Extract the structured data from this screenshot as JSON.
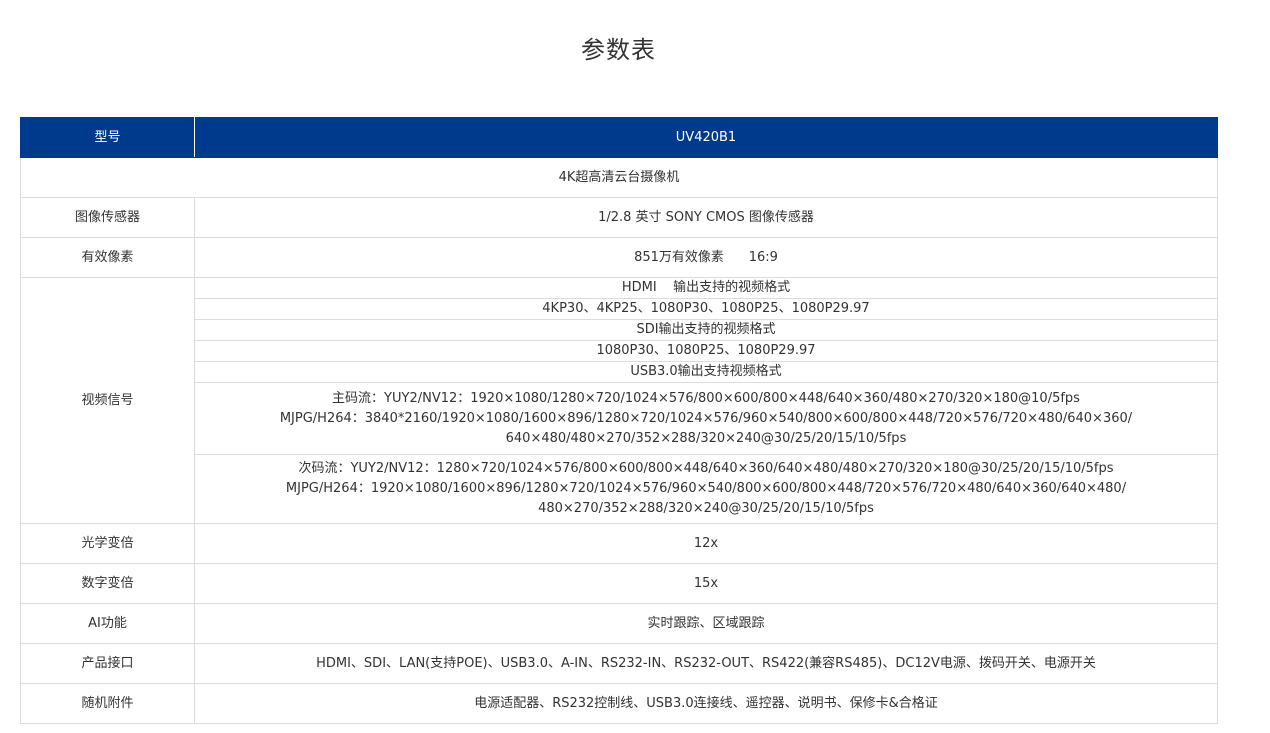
{
  "page": {
    "title": "参数表"
  },
  "table": {
    "header": {
      "label": "型号",
      "value": "UV420B1"
    },
    "product_name": "4K超高清云台摄像机",
    "rows": [
      {
        "label": "图像传感器",
        "value": "1/2.8 英寸 SONY CMOS 图像传感器"
      },
      {
        "label": "有效像素",
        "value": "851万有效像素      16:9"
      }
    ],
    "video": {
      "label": "视频信号",
      "lines": [
        "HDMI    输出支持的视频格式",
        "4KP30、4KP25、1080P30、1080P25、1080P29.97",
        "SDI输出支持的视频格式",
        "1080P30、1080P25、1080P29.97",
        "USB3.0输出支持视频格式"
      ],
      "main_stream": [
        "主码流：YUY2/NV12：1920×1080/1280×720/1024×576/800×600/800×448/640×360/480×270/320×180@10/5fps",
        "MJPG/H264：3840*2160/1920×1080/1600×896/1280×720/1024×576/960×540/800×600/800×448/720×576/720×480/640×360/",
        "640×480/480×270/352×288/320×240@30/25/20/15/10/5fps"
      ],
      "sub_stream": [
        "次码流：YUY2/NV12：1280×720/1024×576/800×600/800×448/640×360/640×480/480×270/320×180@30/25/20/15/10/5fps",
        "MJPG/H264：1920×1080/1600×896/1280×720/1024×576/960×540/800×600/800×448/720×576/720×480/640×360/640×480/",
        "480×270/352×288/320×240@30/25/20/15/10/5fps"
      ]
    },
    "rows_after": [
      {
        "label": "光学变倍",
        "value": "12x"
      },
      {
        "label": "数字变倍",
        "value": "15x"
      },
      {
        "label": "AI功能",
        "value": "实时跟踪、区域跟踪"
      },
      {
        "label": "产品接口",
        "value": "HDMI、SDI、LAN(支持POE)、USB3.0、A-IN、RS232-IN、RS232-OUT、RS422(兼容RS485)、DC12V电源、拨码开关、电源开关"
      },
      {
        "label": "随机附件",
        "value": "电源适配器、RS232控制线、USB3.0连接线、遥控器、说明书、保修卡&合格证"
      }
    ]
  },
  "colors": {
    "header_bg": "#003a8c",
    "header_text": "#ffffff",
    "border": "#dcdcdc",
    "text": "#333333"
  }
}
